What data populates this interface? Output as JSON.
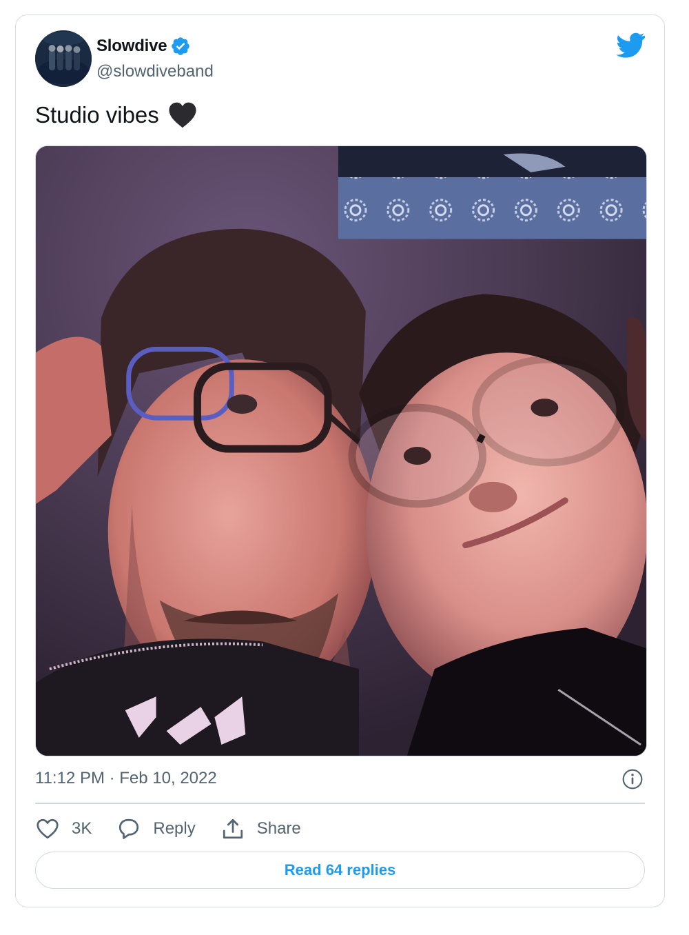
{
  "tweet": {
    "author": {
      "name": "Slowdive",
      "handle": "@slowdiveband",
      "verified": true
    },
    "text": "Studio vibes",
    "emoji": "black-heart",
    "timestamp": "11:12 PM · Feb 10, 2022",
    "likes_count": "3K",
    "reply_label": "Reply",
    "share_label": "Share",
    "read_replies_label": "Read 64 replies"
  },
  "colors": {
    "accent": "#1d9bf0",
    "text_primary": "#0f1419",
    "text_secondary": "#536471",
    "border": "#cfd9de"
  },
  "icons": {
    "brand": "twitter-bird-icon",
    "verified": "verified-badge-icon",
    "info": "info-icon",
    "like": "heart-outline-icon",
    "reply": "speech-bubble-icon",
    "share": "share-upload-icon"
  }
}
